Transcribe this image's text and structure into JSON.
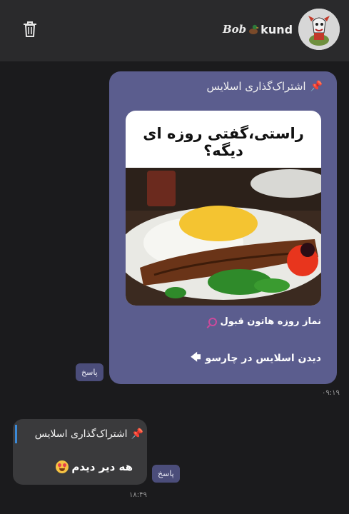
{
  "header": {
    "brand_part1": "Bob",
    "brand_part2": "kund",
    "trash_icon": "trash-icon",
    "avatar_icon": "cartoon-avatar"
  },
  "messages": [
    {
      "quote_title": "اشتراک‌گذاری اسلایس",
      "promo_text": "راستی،گفتی روزه ای دیگه؟",
      "line": "نماز روزه هاتون قبول",
      "link": "دیدن اسلایس در چارسو",
      "reply_label": "پاسخ",
      "time": "۰۹:۱۹"
    },
    {
      "quote_title": "اشتراک‌گذاری اسلایس",
      "text": "هه دیر دیدم",
      "reply_label": "پاسخ",
      "time": "۱۸:۴۹"
    }
  ],
  "colors": {
    "background": "#1b1b1d",
    "header": "#2a2a2c",
    "incoming_bubble": "#5b5d8e",
    "outgoing_bubble": "#3a3a3c",
    "accent_bar": "#3b8ad8"
  }
}
